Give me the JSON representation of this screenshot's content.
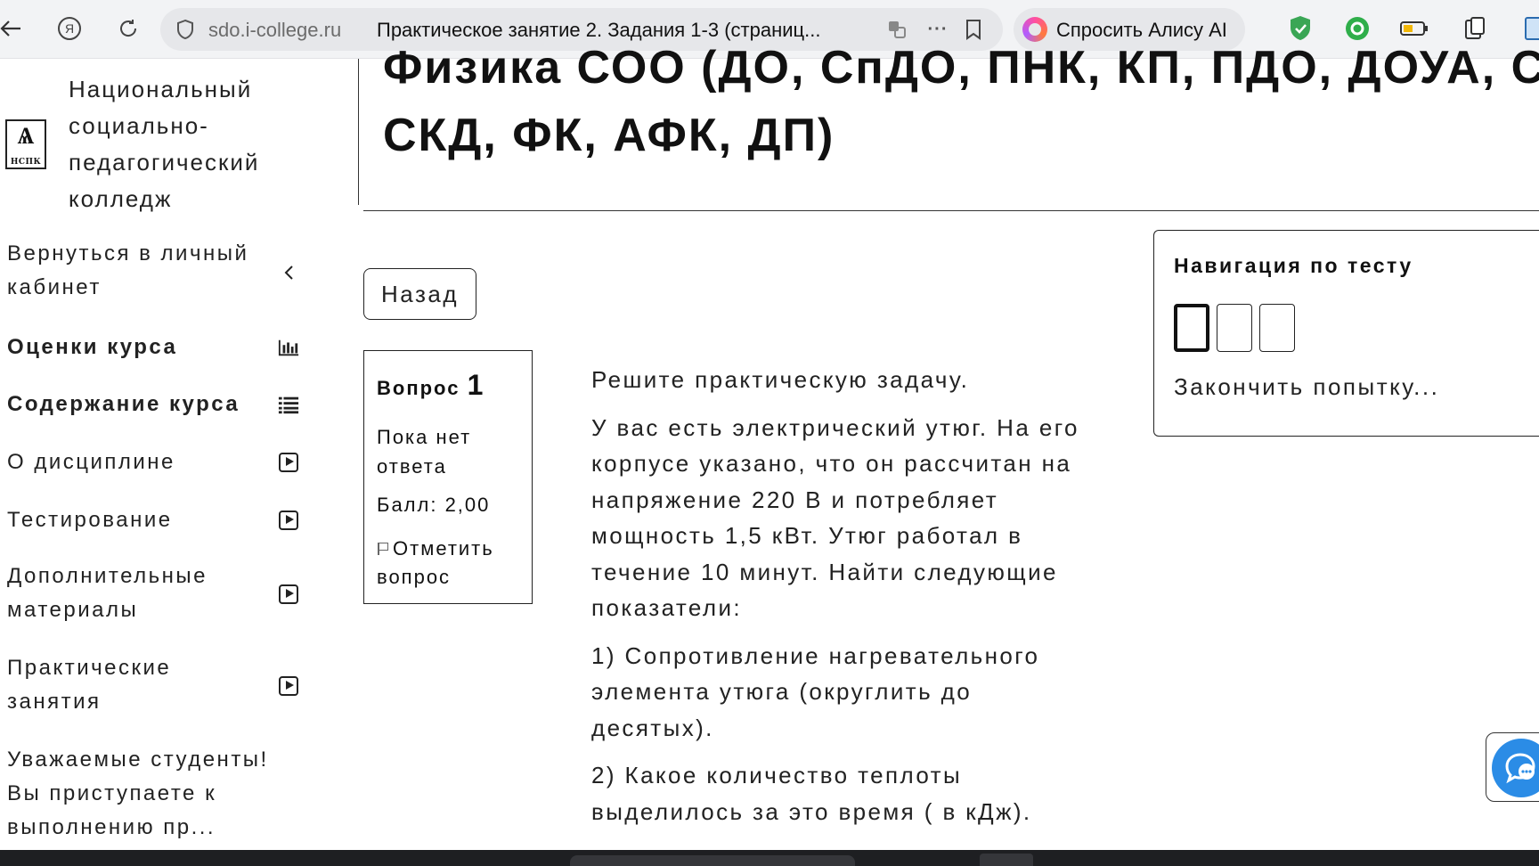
{
  "browser": {
    "domain": "sdo.i-college.ru",
    "tab_title": "Практическое занятие 2. Задания 1-3 (страниц...",
    "alice_label": "Спросить Алису AI"
  },
  "sidebar": {
    "college_name": "Национальный социально-педагогический колледж",
    "logo_text": "НСПК",
    "items": [
      {
        "label": "Вернуться в личный кабинет",
        "icon": "chevron-left-icon"
      },
      {
        "label": "Оценки курса",
        "icon": "bar-chart-icon"
      },
      {
        "label": "Содержание курса",
        "icon": "list-icon"
      },
      {
        "label": "О дисциплине",
        "icon": "play-icon"
      },
      {
        "label": "Тестирование",
        "icon": "play-icon"
      },
      {
        "label": "Дополнительные материалы",
        "icon": "play-icon"
      },
      {
        "label": "Практические занятия",
        "icon": "play-icon"
      },
      {
        "label": "Уважаемые студенты! Вы приступаете к выполнению пр...",
        "icon": ""
      }
    ]
  },
  "main": {
    "course_title_line1": "Физика СОО (ДО, СпДО, ПНК, КП, ПДО, ДОУА, СР,",
    "course_title_line2": "СКД, ФК, АФК, ДП)",
    "back_button": "Назад",
    "question": {
      "label": "Вопрос",
      "number": "1",
      "state": "Пока нет ответа",
      "grade": "Балл: 2,00",
      "flag": "Отметить вопрос"
    },
    "question_text": [
      "Решите практическую задачу.",
      "У вас есть электрический утюг. На его корпусе указано, что он рассчитан на напряжение 220 В и потребляет мощность 1,5 кВт. Утюг работал в течение 10 минут. Найти следующие показатели:",
      "1) Сопротивление нагревательного элемента утюга (округлить до десятых).",
      "2) Какое количество теплоты выделилось за это время ( в кДж)."
    ]
  },
  "quiz_nav": {
    "title": "Навигация по тесту",
    "finish": "Закончить попытку..."
  }
}
